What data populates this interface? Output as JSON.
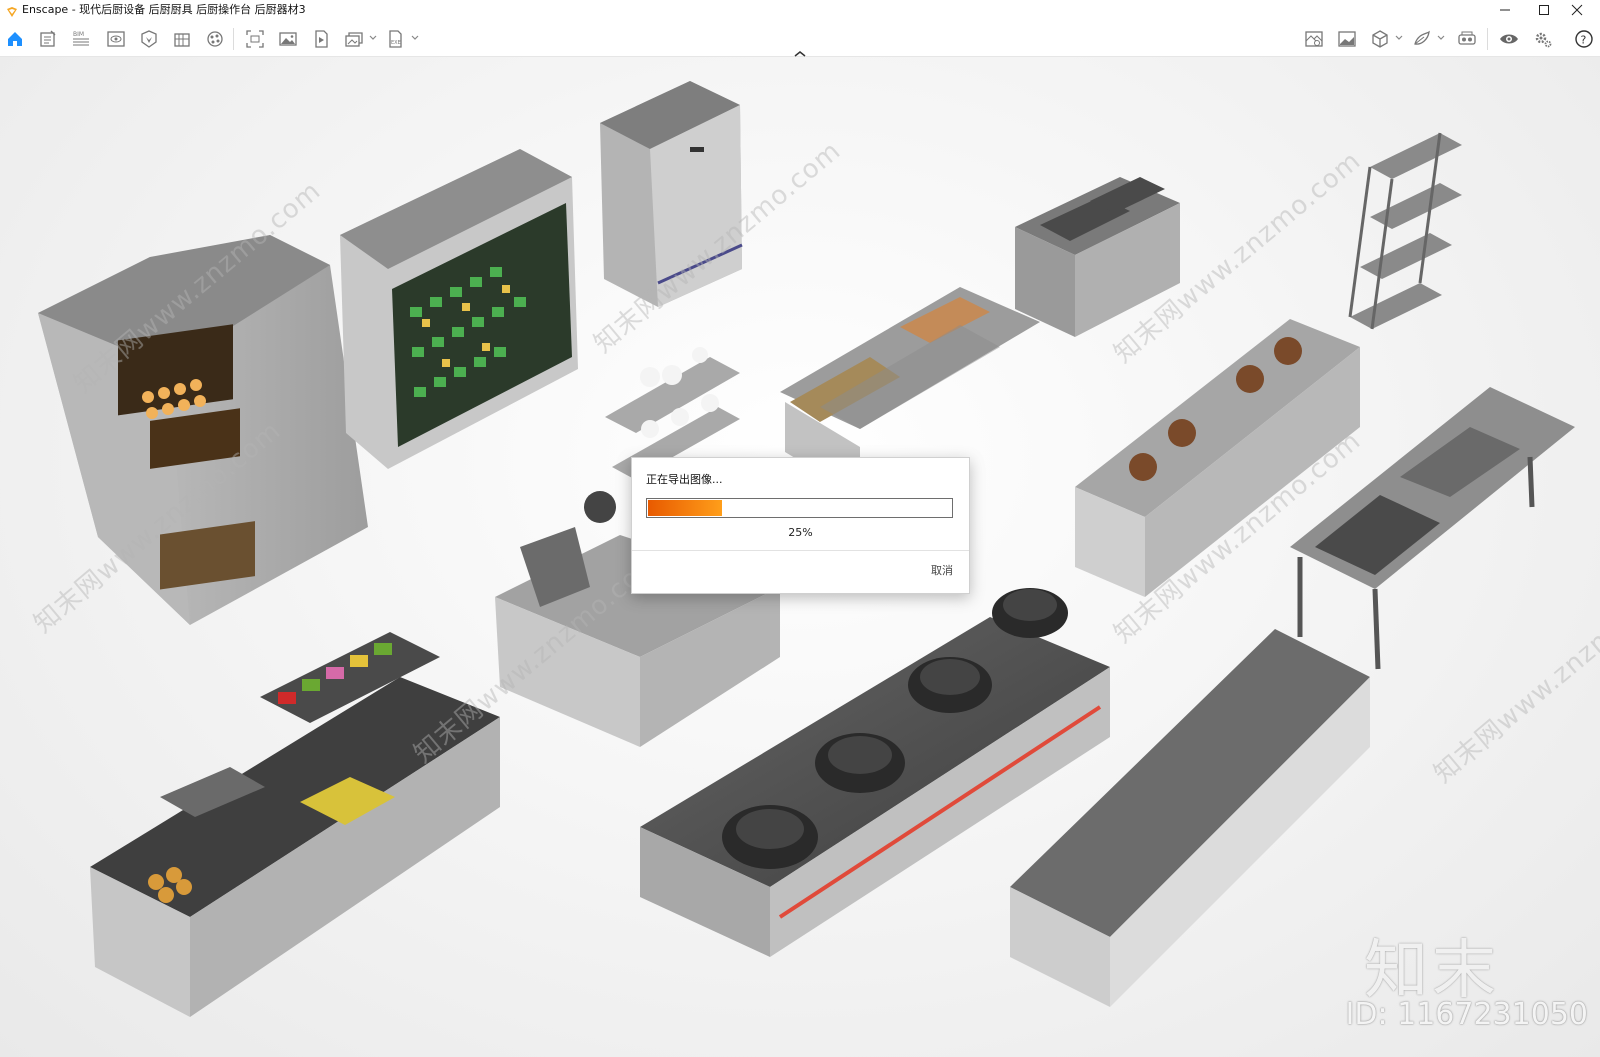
{
  "window": {
    "title": "Enscape - 现代后厨设备 后厨厨具 后厨操作台 后厨器材3"
  },
  "toolbar": {
    "left_icons": [
      "home-icon",
      "notes-icon",
      "bim-icon",
      "view-icon",
      "asset-library-icon",
      "building-icon",
      "material-icon",
      "screenshot-icon",
      "image-icon",
      "video-icon",
      "batch-render-icon",
      "export-icon"
    ],
    "right_icons": [
      "site-context-icon",
      "atmosphere-icon",
      "cube-icon",
      "material-editor-icon",
      "vr-icon",
      "visual-settings-icon",
      "settings-icon",
      "help-icon"
    ]
  },
  "viewport": {
    "watermark": "知末网www.znzmo.com",
    "brand_mark": "知末",
    "image_id": "ID: 1167231050"
  },
  "dialog": {
    "title": "正在导出图像...",
    "progress": 0.25,
    "percent_label": "25%",
    "cancel_label": "取消",
    "accent_color": "#f07a10"
  }
}
